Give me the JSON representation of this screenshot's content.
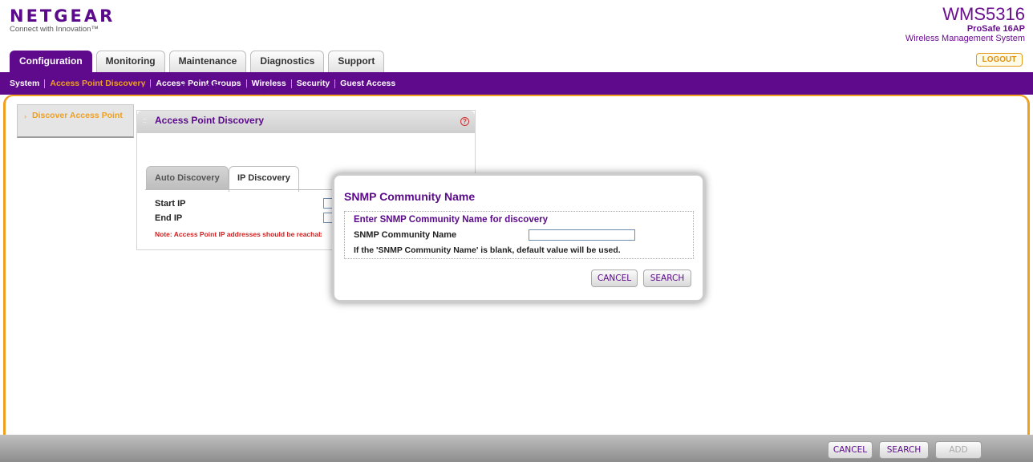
{
  "brand": {
    "logo": "NETGEAR",
    "tagline": "Connect with Innovation™",
    "model": "WMS5316",
    "line": "ProSafe 16AP",
    "product": "Wireless Management System",
    "logout_label": "LOGOUT"
  },
  "main_tabs": [
    {
      "label": "Configuration",
      "active": true
    },
    {
      "label": "Monitoring",
      "active": false
    },
    {
      "label": "Maintenance",
      "active": false
    },
    {
      "label": "Diagnostics",
      "active": false
    },
    {
      "label": "Support",
      "active": false
    }
  ],
  "sub_nav": [
    {
      "label": "System",
      "active": false
    },
    {
      "label": "Access Point Discovery",
      "active": true
    },
    {
      "label": "Access Point Groups",
      "active": false
    },
    {
      "label": "Wireless",
      "active": false
    },
    {
      "label": "Security",
      "active": false
    },
    {
      "label": "Guest Access",
      "active": false
    }
  ],
  "left_nav": {
    "item_label": "Discover Access Point"
  },
  "page": {
    "title": "Access Point Discovery",
    "panel_title": "Access Point Discovery",
    "help_icon": "?",
    "tabs": [
      {
        "label": "Auto Discovery",
        "active": false
      },
      {
        "label": "IP Discovery",
        "active": true
      }
    ],
    "start_ip_label": "Start IP",
    "end_ip_label": "End IP",
    "note": "Note: Access Point IP addresses should be reachable"
  },
  "modal": {
    "title": "SNMP Community Name",
    "subtitle": "Enter SNMP Community Name for discovery",
    "field_label": "SNMP Community Name",
    "field_value": "",
    "hint": "If the 'SNMP Community Name' is blank, default value will be used.",
    "cancel_label": "CANCEL",
    "search_label": "SEARCH"
  },
  "footer": {
    "cancel_label": "CANCEL",
    "search_label": "SEARCH",
    "add_label": "ADD"
  },
  "colors": {
    "brand_purple": "#5f0a8c",
    "accent_orange": "#f0a020",
    "note_red": "#d22020"
  }
}
